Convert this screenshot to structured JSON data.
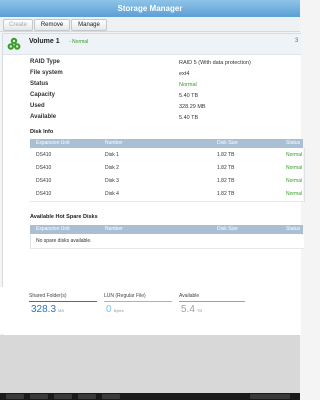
{
  "window": {
    "title": "Storage Manager"
  },
  "toolbar": {
    "create": "Create",
    "remove": "Remove",
    "manage": "Manage"
  },
  "volume": {
    "title": "Volume 1",
    "status_inline": "- Normal",
    "number_hint": "3",
    "properties": [
      {
        "label": "RAID Type",
        "value": "RAID 5 (With data protection)"
      },
      {
        "label": "File system",
        "value": "ext4"
      },
      {
        "label": "Status",
        "value": "Normal"
      },
      {
        "label": "Capacity",
        "value": "5.40 TB"
      },
      {
        "label": "Used",
        "value": "328.29 MB"
      },
      {
        "label": "Available",
        "value": "5.40 TB"
      }
    ]
  },
  "disk_info": {
    "title": "Disk Info",
    "columns": [
      "Expansion Unit",
      "Number",
      "Disk Size",
      "Status"
    ],
    "rows": [
      [
        "DS410",
        "Disk 1",
        "1.82 TB",
        "Normal"
      ],
      [
        "DS410",
        "Disk 2",
        "1.82 TB",
        "Normal"
      ],
      [
        "DS410",
        "Disk 3",
        "1.82 TB",
        "Normal"
      ],
      [
        "DS410",
        "Disk 4",
        "1.82 TB",
        "Normal"
      ]
    ]
  },
  "hot_spare": {
    "title": "Available Hot Spare Disks",
    "columns": [
      "Expansion Unit",
      "Number",
      "Disk Size",
      "Status"
    ],
    "empty_text": "No spare disks available."
  },
  "stats": {
    "shared": {
      "label": "Shared Folder(s)",
      "value": "328.3",
      "unit": "MB"
    },
    "lun": {
      "label": "LUN (Regular File)",
      "value": "0",
      "unit": "Bytes"
    },
    "available": {
      "label": "Available",
      "value": "5.4",
      "unit": "TB"
    }
  },
  "colors": {
    "title_bar": "#5a9fd4",
    "normal_status": "#3a9a2a",
    "shared_color": "#2a73c6",
    "lun_color": "#7fc0e8",
    "available_color": "#9aa3aa"
  },
  "icons": {
    "volume": "volume-stack-icon"
  }
}
